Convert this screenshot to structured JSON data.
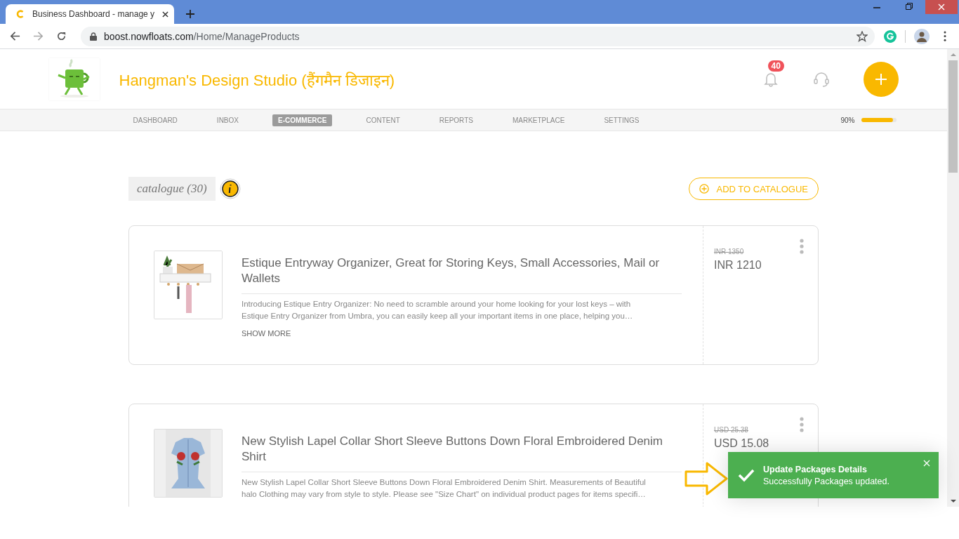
{
  "browser": {
    "tab_title": "Business Dashboard - manage y",
    "url_host": "boost.nowfloats.com",
    "url_path": "/Home/ManageProducts"
  },
  "header": {
    "business_name": "Hangman's Design Studio (हैंगमैन डिजाइन)",
    "notification_count": "40"
  },
  "nav": [
    {
      "label": "DASHBOARD",
      "selected": false
    },
    {
      "label": "INBOX",
      "selected": false
    },
    {
      "label": "E-COMMERCE",
      "selected": true
    },
    {
      "label": "CONTENT",
      "selected": false
    },
    {
      "label": "REPORTS",
      "selected": false
    },
    {
      "label": "MARKETPLACE",
      "selected": false
    },
    {
      "label": "SETTINGS",
      "selected": false
    }
  ],
  "profile_completion": {
    "reading": "90%",
    "level": 0.9
  },
  "catalogue": {
    "title": "catalogue (30)",
    "add_button": "ADD TO CATALOGUE"
  },
  "products": [
    {
      "name": "Estique Entryway Organizer, Great for Storing Keys, Small Accessories, Mail or Wallets",
      "description_lines": [
        "Introducing Estique Entry Organizer: No need to scramble around your home looking for your lost keys – with",
        "Estique Entry Organizer from Umbra, you can easily keep all your important items in one place, helping you…"
      ],
      "original_price": "INR 1350",
      "price": "INR 1210",
      "show_more": "SHOW MORE",
      "kind": "organizer"
    },
    {
      "name": "New Stylish Lapel Collar Short Sleeve Buttons Down Floral Embroidered Denim Shirt",
      "description_lines": [
        "New Stylish Lapel Collar Short Sleeve Buttons Down Floral Embroidered Denim Shirt. Measurements of Beautiful",
        "halo Clothing may vary from style to style. Please see \"Size Chart\" on individual product pages for items specifi…"
      ],
      "original_price": "USD 25.38",
      "price": "USD 15.08",
      "kind": "shirt"
    }
  ],
  "toast": {
    "title": "Update Packages Details",
    "message": "Successfully Packages updated."
  }
}
